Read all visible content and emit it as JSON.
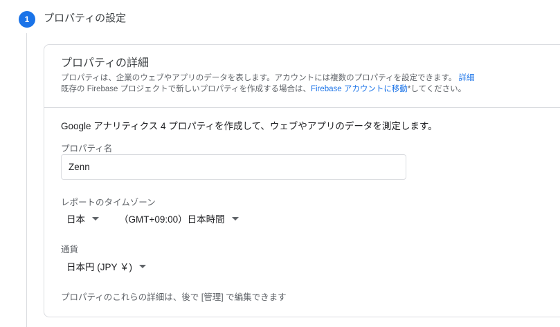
{
  "step": {
    "number": "1",
    "title": "プロパティの設定"
  },
  "card": {
    "title": "プロパティの詳細",
    "desc_line1": "プロパティは、企業のウェブやアプリのデータを表します。アカウントには複数のプロパティを設定できます。",
    "desc_line1_link": "詳細",
    "desc_line2_prefix": "既存の Firebase プロジェクトで新しいプロパティを作成する場合は、",
    "desc_line2_link": "Firebase アカウントに移動",
    "desc_line2_suffix": "*してください。",
    "intro": "Google アナリティクス 4 プロパティを作成して、ウェブやアプリのデータを測定します。",
    "property_name_label": "プロパティ名",
    "property_name_value": "Zenn",
    "timezone_label": "レポートのタイムゾーン",
    "country_value": "日本",
    "timezone_value": "（GMT+09:00）日本時間",
    "currency_label": "通貨",
    "currency_value": "日本円 (JPY ￥)",
    "footnote": "プロパティのこれらの詳細は、後で [管理] で編集できます"
  },
  "colors": {
    "accent": "#1a73e8",
    "border": "#dadce0",
    "secondary_text": "#5f6368"
  }
}
